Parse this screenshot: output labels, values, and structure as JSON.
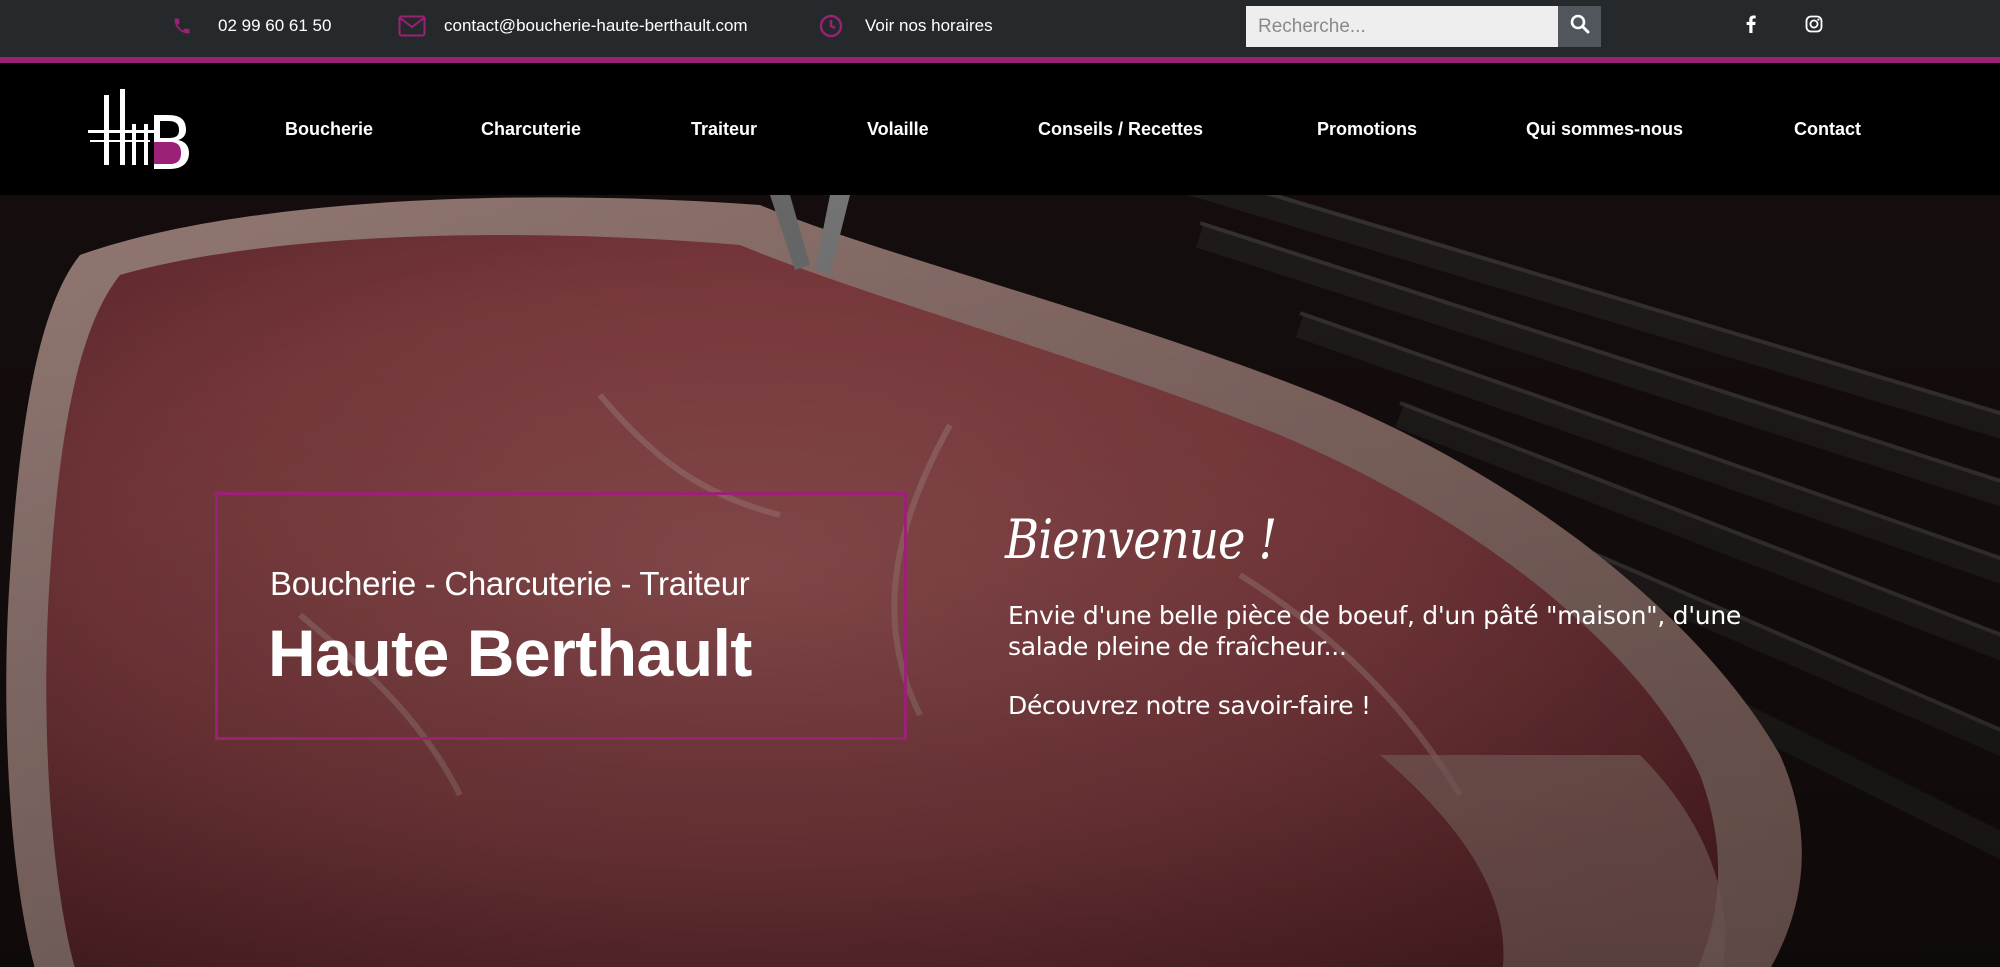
{
  "topbar": {
    "phone": "02 99 60 61 50",
    "email": "contact@boucherie-haute-berthault.com",
    "hours_link": "Voir nos horaires",
    "search_placeholder": "Recherche...",
    "accent_color": "#9b2176"
  },
  "social": {
    "facebook_icon": "facebook-icon",
    "instagram_icon": "instagram-icon"
  },
  "nav": {
    "items": [
      {
        "label": "Boucherie"
      },
      {
        "label": "Charcuterie"
      },
      {
        "label": "Traiteur"
      },
      {
        "label": "Volaille"
      },
      {
        "label": "Conseils / Recettes"
      },
      {
        "label": "Promotions"
      },
      {
        "label": "Qui sommes-nous"
      },
      {
        "label": "Contact"
      }
    ]
  },
  "hero": {
    "subtitle": "Boucherie - Charcuterie - Traiteur",
    "title": "Haute Berthault",
    "welcome": "Bienvenue !",
    "text": "Envie d'une belle pièce de boeuf, d'un pâté \"maison\", d'une salade pleine de fraîcheur...",
    "cta": "Découvrez notre savoir-faire !"
  }
}
